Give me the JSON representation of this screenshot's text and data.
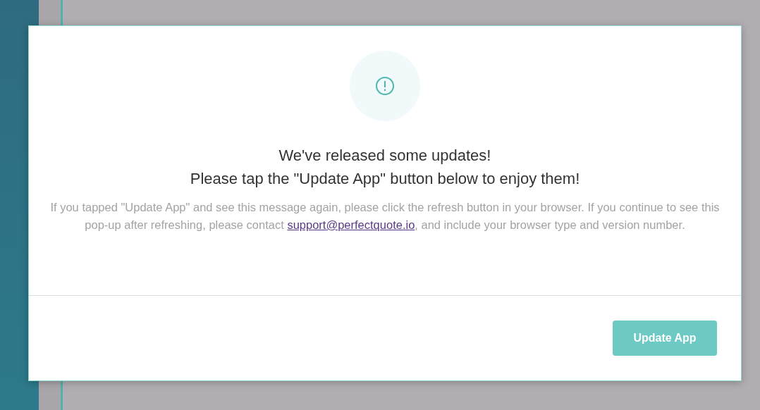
{
  "dialog": {
    "title_lines": [
      "We've released some updates!",
      "Please tap the \"Update App\" button below to enjoy them!"
    ],
    "message": {
      "before": "If you tapped \"Update App\" and see this message again, please click the refresh button in your browser. If you continue to see this pop-up after refreshing, please contact ",
      "link": "support@perfectquote.io",
      "after": ", and include your browser type and version number."
    },
    "button": "Update App"
  }
}
